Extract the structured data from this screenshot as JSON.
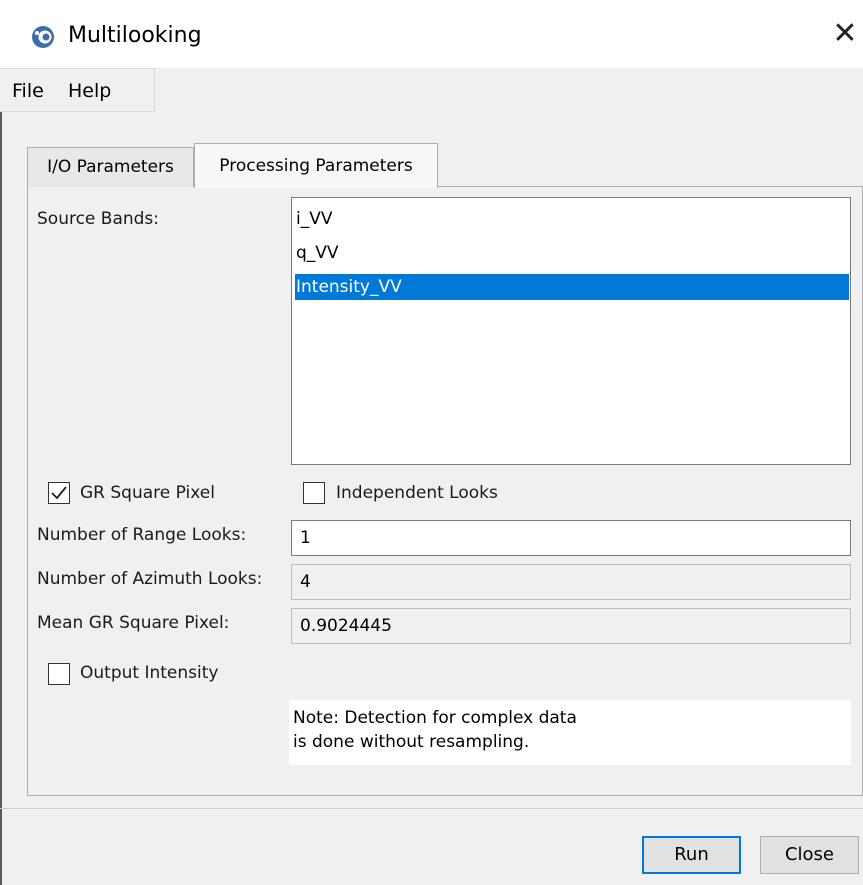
{
  "window": {
    "title": "Multilooking",
    "icon": "app-logo-icon",
    "close_glyph": "✕"
  },
  "menu": {
    "items": [
      "File",
      "Help"
    ]
  },
  "tabs": [
    {
      "label": "I/O Parameters",
      "selected": false
    },
    {
      "label": "Processing Parameters",
      "selected": true
    }
  ],
  "source_bands": {
    "label": "Source Bands:",
    "items": [
      {
        "label": "i_VV",
        "selected": false
      },
      {
        "label": "q_VV",
        "selected": false
      },
      {
        "label": "Intensity_VV",
        "selected": true
      }
    ]
  },
  "options": {
    "gr_square_pixel": {
      "label": "GR Square Pixel",
      "checked": true
    },
    "independent_looks": {
      "label": "Independent Looks",
      "checked": false
    },
    "output_intensity": {
      "label": "Output Intensity",
      "checked": false
    }
  },
  "fields": {
    "range_looks": {
      "label": "Number of Range Looks:",
      "value": "1",
      "editable": true
    },
    "azimuth_looks": {
      "label": "Number of Azimuth Looks:",
      "value": "4",
      "editable": false
    },
    "mean_gr_square_pixel": {
      "label": "Mean GR Square Pixel:",
      "value": "0.9024445",
      "editable": false
    }
  },
  "note": {
    "line1": "Note: Detection for complex data",
    "line2": "is done without resampling."
  },
  "buttons": {
    "run": "Run",
    "close": "Close"
  },
  "colors": {
    "selection": "#0078d7",
    "window_bg": "#f0f0f0",
    "focus_border": "#0078d7"
  }
}
